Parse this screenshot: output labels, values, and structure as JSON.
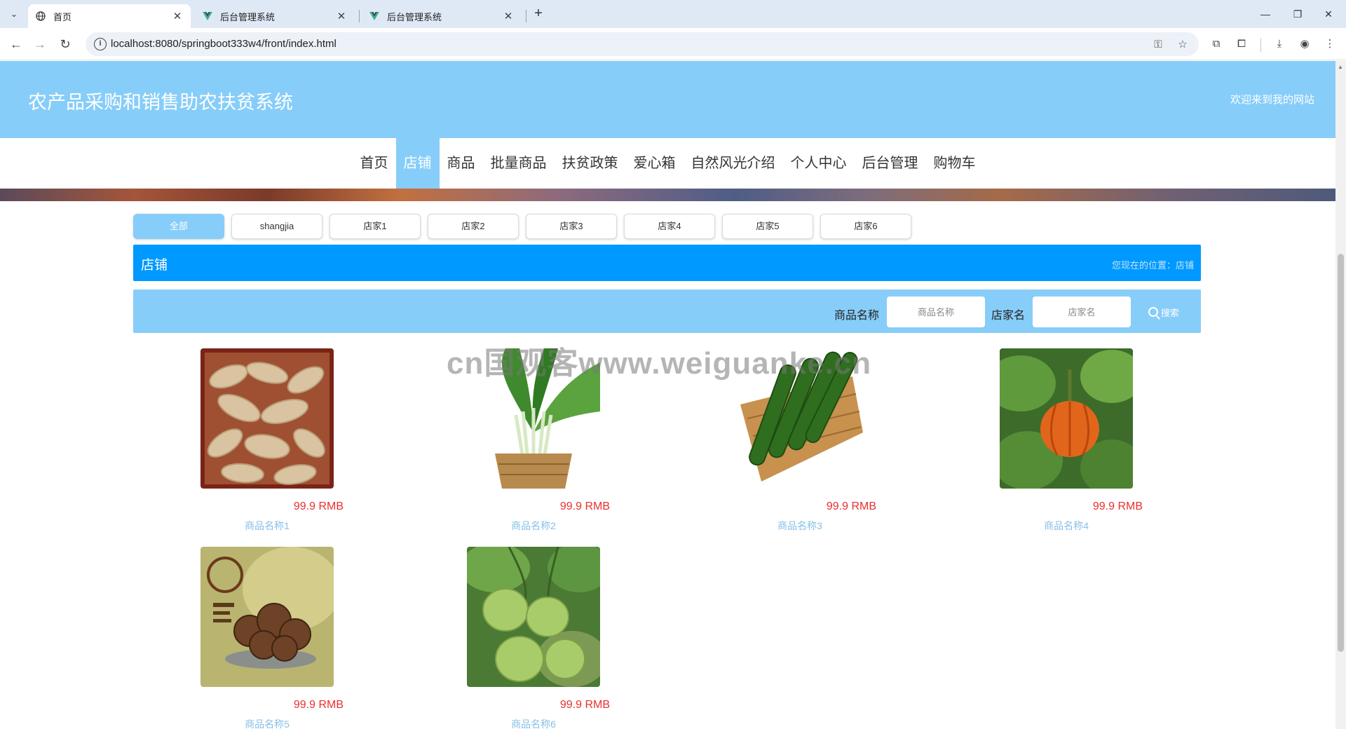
{
  "browser": {
    "tabs": [
      {
        "title": "首页",
        "active": true
      },
      {
        "title": "后台管理系统",
        "active": false
      },
      {
        "title": "后台管理系统",
        "active": false
      }
    ],
    "url": "localhost:8080/springboot333w4/front/index.html"
  },
  "site": {
    "title": "农产品采购和销售助农扶贫系统",
    "welcome": "欢迎来到我的网站"
  },
  "nav": {
    "items": [
      "首页",
      "店铺",
      "商品",
      "批量商品",
      "扶贫政策",
      "爱心箱",
      "自然风光介绍",
      "个人中心",
      "后台管理",
      "购物车"
    ],
    "active_index": 1
  },
  "filters": {
    "items": [
      "全部",
      "shangjia",
      "店家1",
      "店家2",
      "店家3",
      "店家4",
      "店家5",
      "店家6"
    ],
    "active_index": 0
  },
  "section": {
    "title": "店铺",
    "breadcrumb": "您现在的位置：店铺"
  },
  "search": {
    "product_label": "商品名称",
    "product_placeholder": "商品名称",
    "shop_label": "店家名",
    "shop_placeholder": "店家名",
    "button_label": "搜索"
  },
  "products": [
    {
      "name": "商品名称1",
      "price": "99.9 RMB",
      "image": "ginger"
    },
    {
      "name": "商品名称2",
      "price": "99.9 RMB",
      "image": "leafy-greens"
    },
    {
      "name": "商品名称3",
      "price": "99.9 RMB",
      "image": "cucumbers"
    },
    {
      "name": "商品名称4",
      "price": "99.9 RMB",
      "image": "pumpkin"
    },
    {
      "name": "商品名称5",
      "price": "99.9 RMB",
      "image": "mushrooms"
    },
    {
      "name": "商品名称6",
      "price": "99.9 RMB",
      "image": "green-fruit"
    }
  ],
  "watermark": "cn国观客www.weiguanke.cn",
  "colors": {
    "header": "#87cdf9",
    "section_bar": "#0099ff",
    "price": "#e8302d"
  }
}
